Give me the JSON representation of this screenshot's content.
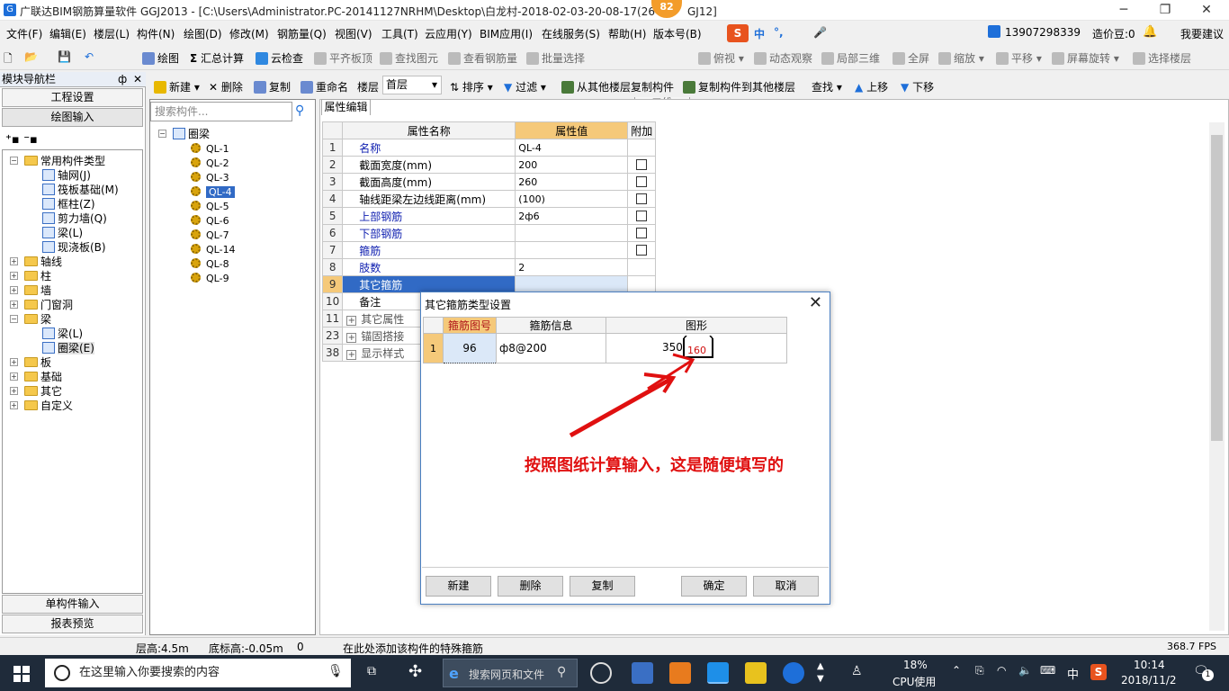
{
  "window": {
    "title": "广联达BIM钢筋算量软件 GGJ2013 - [C:\\Users\\Administrator.PC-20141127NRHM\\Desktop\\白龙村-2018-02-03-20-08-17(26",
    "title_suffix": "GJ12]",
    "badge": "82",
    "min": "─",
    "max": "❐",
    "close": "✕"
  },
  "menu": {
    "items": [
      "文件(F)",
      "编辑(E)",
      "楼层(L)",
      "构件(N)",
      "绘图(D)",
      "修改(M)",
      "钢筋量(Q)",
      "视图(V)",
      "工具(T)",
      "云应用(Y)",
      "BIM应用(I)",
      "在线服务(S)",
      "帮助(H)",
      "版本号(B)"
    ],
    "ime": [
      "中",
      "°,",
      "🎤"
    ],
    "phone": "13907298339",
    "price": "造价豆:0",
    "suggest": "我要建议"
  },
  "toolbar1": {
    "draw": "绘图",
    "sum": "汇总计算",
    "cloud": "云检查",
    "align": "平齐板顶",
    "find": "查找图元",
    "view": "查看钢筋量",
    "batch": "批量选择",
    "view2d": "二维",
    "look": "俯视",
    "dynamic": "动态观察",
    "local3d": "局部三维",
    "fullscreen": "全屏",
    "zoom": "缩放",
    "pan": "平移",
    "rotate": "屏幕旋转",
    "floor": "选择楼层"
  },
  "toolbar2": {
    "new": "新建",
    "delete": "删除",
    "copy": "复制",
    "rename": "重命名",
    "floor_label": "楼层",
    "floor_value": "首层",
    "sort": "排序",
    "filter": "过滤",
    "copy_from": "从其他楼层复制构件",
    "copy_to": "复制构件到其他楼层",
    "find": "查找",
    "up": "上移",
    "down": "下移"
  },
  "nav": {
    "header": "模块导航栏",
    "pin": "ф",
    "close": "✕",
    "project_settings": "工程设置",
    "drawing_input": "绘图输入",
    "single_input": "单构件输入",
    "report": "报表预览",
    "tree": [
      {
        "label": "常用构件类型",
        "level": 0,
        "type": "folder",
        "open": true
      },
      {
        "label": "轴网(J)",
        "level": 1,
        "type": "item"
      },
      {
        "label": "筏板基础(M)",
        "level": 1,
        "type": "item"
      },
      {
        "label": "框柱(Z)",
        "level": 1,
        "type": "item"
      },
      {
        "label": "剪力墙(Q)",
        "level": 1,
        "type": "item"
      },
      {
        "label": "梁(L)",
        "level": 1,
        "type": "item"
      },
      {
        "label": "现浇板(B)",
        "level": 1,
        "type": "item"
      },
      {
        "label": "轴线",
        "level": 0,
        "type": "folder"
      },
      {
        "label": "柱",
        "level": 0,
        "type": "folder"
      },
      {
        "label": "墙",
        "level": 0,
        "type": "folder"
      },
      {
        "label": "门窗洞",
        "level": 0,
        "type": "folder"
      },
      {
        "label": "梁",
        "level": 0,
        "type": "folder",
        "open": true
      },
      {
        "label": "梁(L)",
        "level": 1,
        "type": "item"
      },
      {
        "label": "圈梁(E)",
        "level": 1,
        "type": "item",
        "selected": true
      },
      {
        "label": "板",
        "level": 0,
        "type": "folder"
      },
      {
        "label": "基础",
        "level": 0,
        "type": "folder"
      },
      {
        "label": "其它",
        "level": 0,
        "type": "folder"
      },
      {
        "label": "自定义",
        "level": 0,
        "type": "folder"
      }
    ]
  },
  "components": {
    "search_placeholder": "搜索构件...",
    "root": "圈梁",
    "items": [
      "QL-1",
      "QL-2",
      "QL-3",
      "QL-4",
      "QL-5",
      "QL-6",
      "QL-7",
      "QL-14",
      "QL-8",
      "QL-9"
    ],
    "selected": "QL-4"
  },
  "props": {
    "tab": "属性编辑",
    "headers": [
      "属性名称",
      "属性值",
      "附加"
    ],
    "rows": [
      {
        "n": "1",
        "name": "名称",
        "value": "QL-4",
        "blue": true,
        "chk": false
      },
      {
        "n": "2",
        "name": "截面宽度(mm)",
        "value": "200",
        "chk": true
      },
      {
        "n": "3",
        "name": "截面高度(mm)",
        "value": "260",
        "chk": true
      },
      {
        "n": "4",
        "name": "轴线距梁左边线距离(mm)",
        "value": "(100)",
        "chk": true
      },
      {
        "n": "5",
        "name": "上部钢筋",
        "value": "2ф6",
        "blue": true,
        "chk": true
      },
      {
        "n": "6",
        "name": "下部钢筋",
        "value": "",
        "blue": true,
        "chk": true
      },
      {
        "n": "7",
        "name": "箍筋",
        "value": "",
        "blue": true,
        "chk": true
      },
      {
        "n": "8",
        "name": "肢数",
        "value": "2",
        "blue": true,
        "chk": false
      },
      {
        "n": "9",
        "name": "其它箍筋",
        "value": "",
        "selected": true,
        "chk": false
      },
      {
        "n": "10",
        "name": "备注",
        "value": "",
        "chk": false
      },
      {
        "n": "11",
        "name": "其它属性",
        "value": "",
        "plus": true,
        "gray": true
      },
      {
        "n": "23",
        "name": "锚固搭接",
        "value": "",
        "plus": true,
        "gray": true
      },
      {
        "n": "38",
        "name": "显示样式",
        "value": "",
        "plus": true,
        "gray": true
      }
    ]
  },
  "dialog": {
    "title": "其它箍筋类型设置",
    "headers": [
      "箍筋图号",
      "箍筋信息",
      "图形"
    ],
    "row": {
      "n": "1",
      "code": "96",
      "info": "ф8@200",
      "dim1": "350",
      "dim2": "160"
    },
    "buttons": {
      "new": "新建",
      "delete": "删除",
      "copy": "复制",
      "ok": "确定",
      "cancel": "取消"
    }
  },
  "annotation": "按照图纸计算输入，这是随便填写的",
  "status": {
    "floor_height": "层高:4.5m",
    "bottom_height": "底标高:-0.05m",
    "zero": "0",
    "hint": "在此处添加该构件的特殊箍筋",
    "fps": "368.7 FPS"
  },
  "taskbar": {
    "search": "在这里输入你要搜索的内容",
    "browser_search": "搜索网页和文件",
    "cpu_pct": "18%",
    "cpu_label": "CPU使用",
    "ime": "中",
    "time": "10:14",
    "date": "2018/11/2",
    "notif": "1"
  },
  "colors": {
    "accent": "#316ac5",
    "annotation": "#e01010",
    "header_orange": "#f5c97a"
  }
}
